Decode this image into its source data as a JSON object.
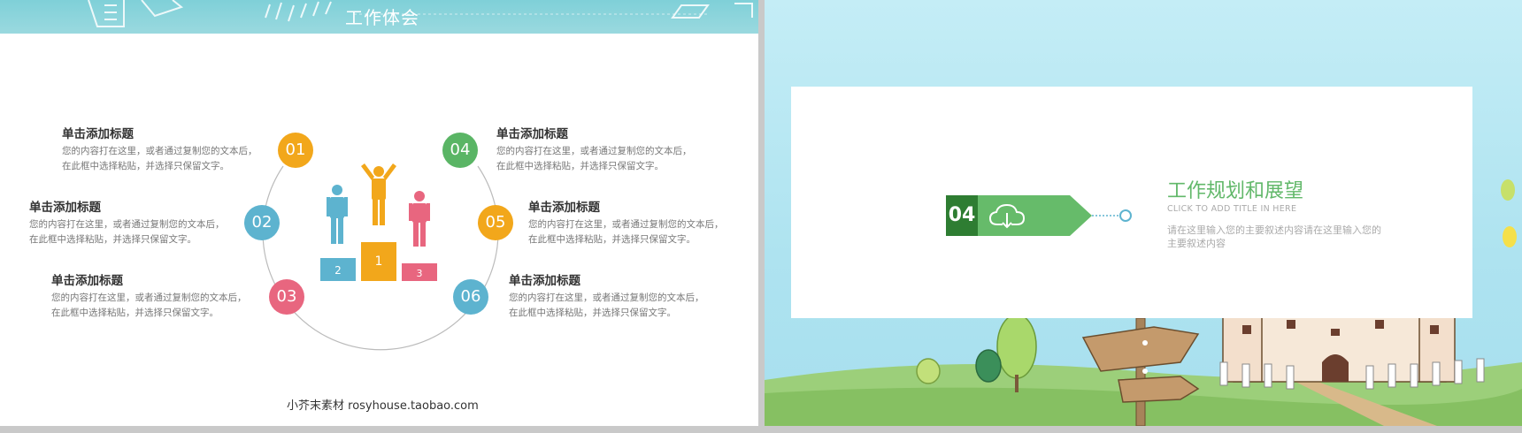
{
  "left_slide": {
    "header_title": "工作体会",
    "footer": "小芥末素材 rosyhouse.taobao.com",
    "items": [
      {
        "num": "01",
        "color": "#f2a71b",
        "title": "单击添加标题",
        "line1": "您的内容打在这里，或者通过复制您的文本后，",
        "line2": "在此框中选择粘贴，并选择只保留文字。"
      },
      {
        "num": "02",
        "color": "#5db3cf",
        "title": "单击添加标题",
        "line1": "您的内容打在这里，或者通过复制您的文本后，",
        "line2": "在此框中选择粘贴，并选择只保留文字。"
      },
      {
        "num": "03",
        "color": "#e8667f",
        "title": "单击添加标题",
        "line1": "您的内容打在这里，或者通过复制您的文本后，",
        "line2": "在此框中选择粘贴，并选择只保留文字。"
      },
      {
        "num": "04",
        "color": "#5ab565",
        "title": "单击添加标题",
        "line1": "您的内容打在这里，或者通过复制您的文本后，",
        "line2": "在此框中选择粘贴，并选择只保留文字。"
      },
      {
        "num": "05",
        "color": "#f2a71b",
        "title": "单击添加标题",
        "line1": "您的内容打在这里，或者通过复制您的文本后，",
        "line2": "在此框中选择粘贴，并选择只保留文字。"
      },
      {
        "num": "06",
        "color": "#5db3cf",
        "title": "单击添加标题",
        "line1": "您的内容打在这里，或者通过复制您的文本后，",
        "line2": "在此框中选择粘贴，并选择只保留文字。"
      }
    ],
    "podium": {
      "first": "1",
      "second": "2",
      "third": "3"
    }
  },
  "right_slide": {
    "badge_num": "04",
    "title": "工作规划和展望",
    "subtitle": "CLICK TO ADD TITLE IN HERE",
    "body": "请在这里输入您的主要叙述内容请在这里输入您的主要叙述内容",
    "icon": "cloud-download-icon",
    "colors": {
      "dark_green": "#2e7d32",
      "green": "#66bb6a",
      "title_green": "#62b86a"
    }
  }
}
